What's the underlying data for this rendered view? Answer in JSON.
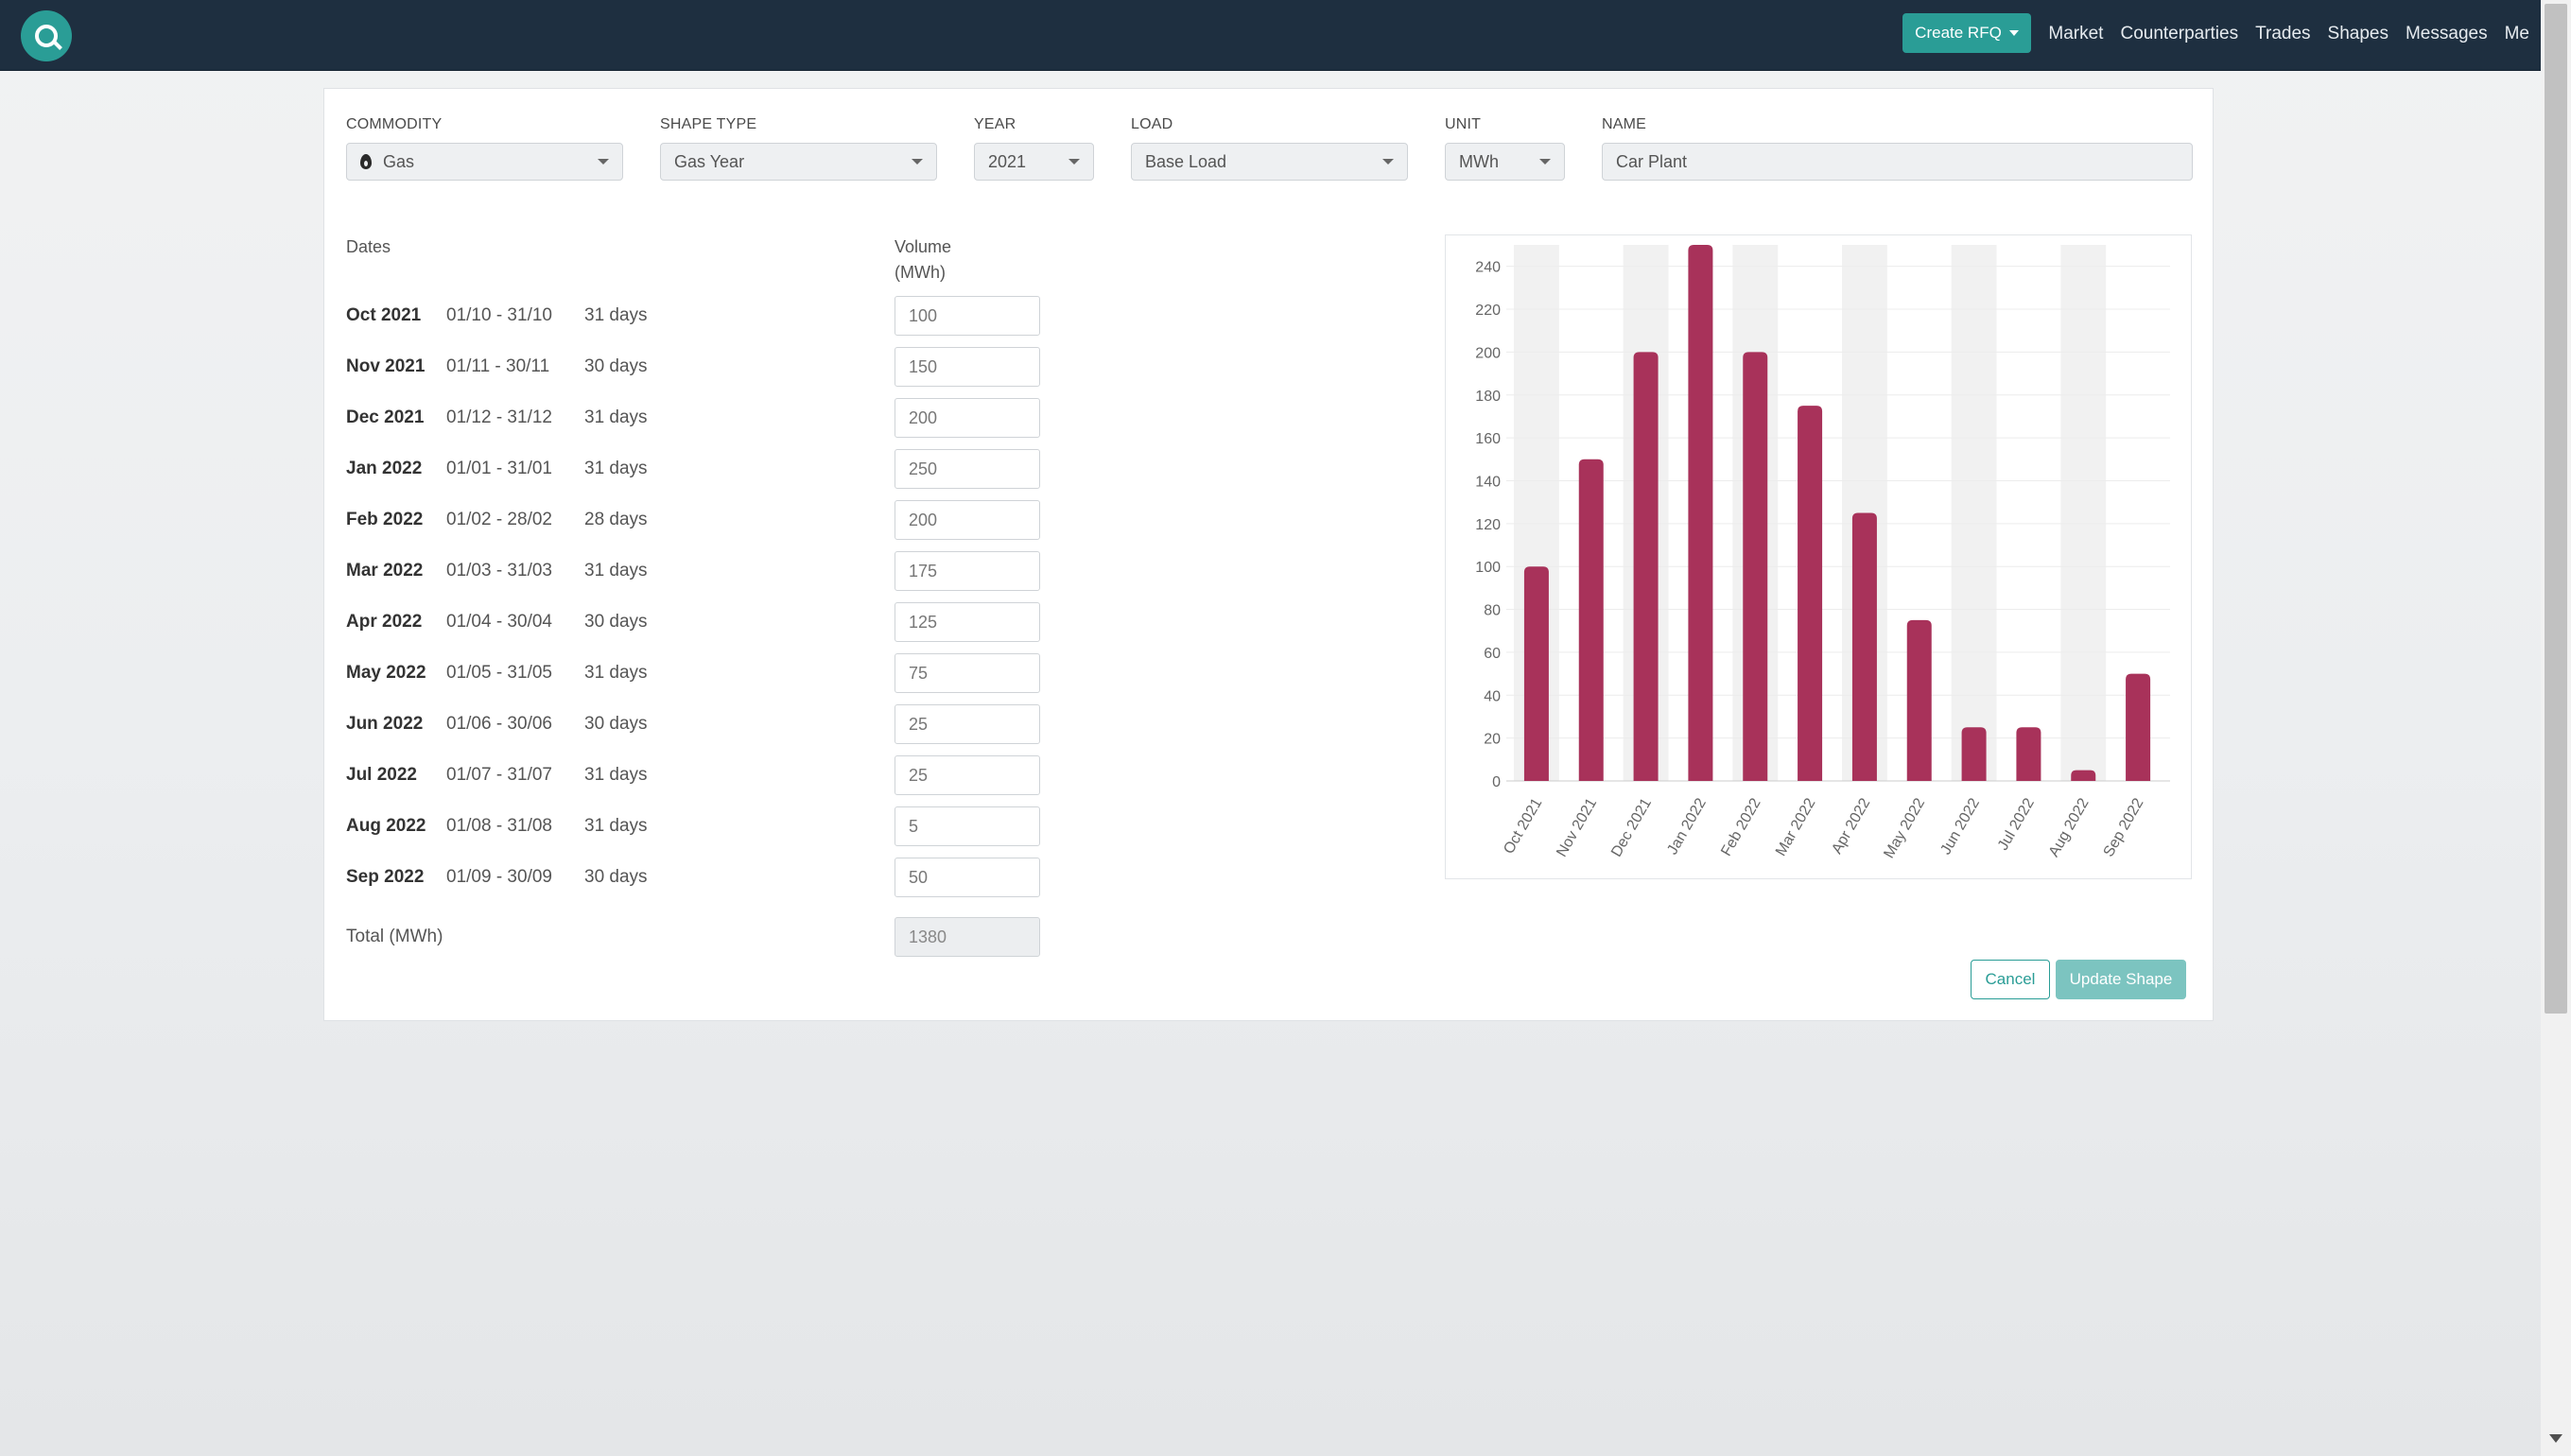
{
  "nav": {
    "create_rfq": "Create RFQ",
    "links": [
      "Market",
      "Counterparties",
      "Trades",
      "Shapes",
      "Messages",
      "Me"
    ]
  },
  "form": {
    "commodity": {
      "label": "COMMODITY",
      "value": "Gas",
      "icon": "flame-icon"
    },
    "shape_type": {
      "label": "SHAPE TYPE",
      "value": "Gas Year"
    },
    "year": {
      "label": "YEAR",
      "value": "2021"
    },
    "load": {
      "label": "LOAD",
      "value": "Base Load"
    },
    "unit": {
      "label": "UNIT",
      "value": "MWh"
    },
    "name": {
      "label": "NAME",
      "value": "Car Plant"
    }
  },
  "table": {
    "dates_header": "Dates",
    "volume_header_line1": "Volume",
    "volume_header_line2": "(MWh)",
    "rows": [
      {
        "month": "Oct 2021",
        "range": "01/10 - 31/10",
        "days": "31 days",
        "volume": "100"
      },
      {
        "month": "Nov 2021",
        "range": "01/11 - 30/11",
        "days": "30 days",
        "volume": "150"
      },
      {
        "month": "Dec 2021",
        "range": "01/12 - 31/12",
        "days": "31 days",
        "volume": "200"
      },
      {
        "month": "Jan 2022",
        "range": "01/01 - 31/01",
        "days": "31 days",
        "volume": "250"
      },
      {
        "month": "Feb 2022",
        "range": "01/02 - 28/02",
        "days": "28 days",
        "volume": "200"
      },
      {
        "month": "Mar 2022",
        "range": "01/03 - 31/03",
        "days": "31 days",
        "volume": "175"
      },
      {
        "month": "Apr 2022",
        "range": "01/04 - 30/04",
        "days": "30 days",
        "volume": "125"
      },
      {
        "month": "May 2022",
        "range": "01/05 - 31/05",
        "days": "31 days",
        "volume": "75"
      },
      {
        "month": "Jun 2022",
        "range": "01/06 - 30/06",
        "days": "30 days",
        "volume": "25"
      },
      {
        "month": "Jul 2022",
        "range": "01/07 - 31/07",
        "days": "31 days",
        "volume": "25"
      },
      {
        "month": "Aug 2022",
        "range": "01/08 - 31/08",
        "days": "31 days",
        "volume": "5"
      },
      {
        "month": "Sep 2022",
        "range": "01/09 - 30/09",
        "days": "30 days",
        "volume": "50"
      }
    ],
    "total_label": "Total (MWh)",
    "total_value": "1380"
  },
  "actions": {
    "cancel": "Cancel",
    "update": "Update Shape"
  },
  "colors": {
    "accent": "#2a9d96",
    "bar": "#a8325a",
    "band": "#f1f1f1",
    "navbar": "#1e2f40"
  },
  "chart_data": {
    "type": "bar",
    "categories": [
      "Oct 2021",
      "Nov 2021",
      "Dec 2021",
      "Jan 2022",
      "Feb 2022",
      "Mar 2022",
      "Apr 2022",
      "May 2022",
      "Jun 2022",
      "Jul 2022",
      "Aug 2022",
      "Sep 2022"
    ],
    "values": [
      100,
      150,
      200,
      250,
      200,
      175,
      125,
      75,
      25,
      25,
      5,
      50
    ],
    "ylim": [
      0,
      250
    ],
    "yticks": [
      0,
      20,
      40,
      60,
      80,
      100,
      120,
      140,
      160,
      180,
      200,
      220,
      240
    ],
    "grid": true,
    "legend": "none"
  }
}
